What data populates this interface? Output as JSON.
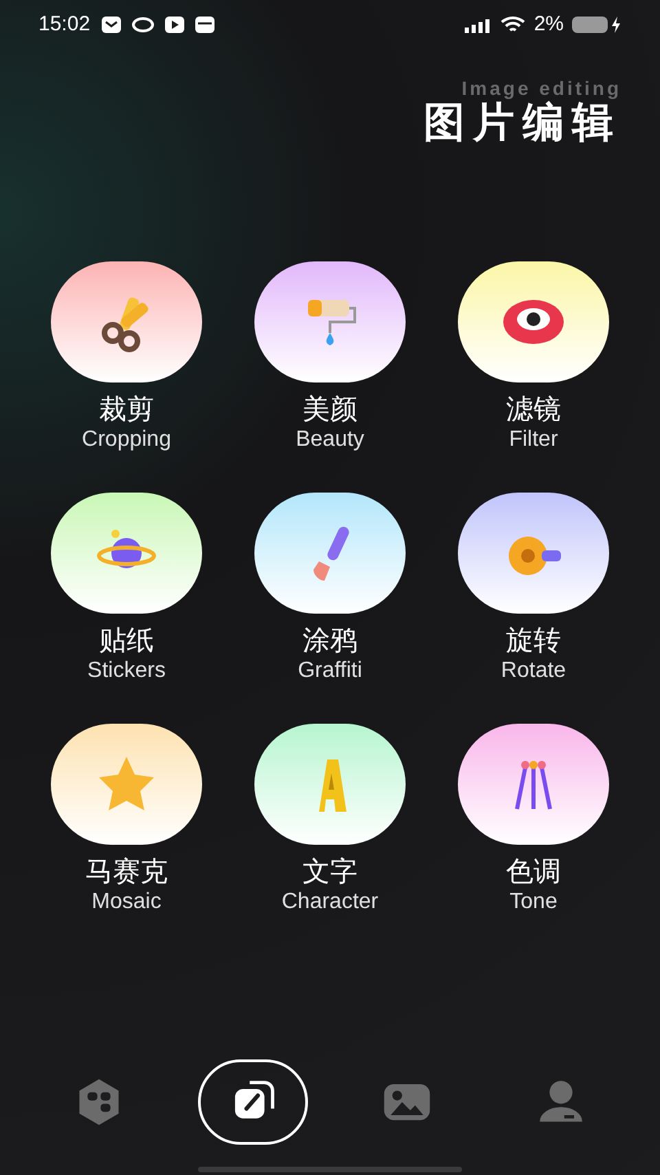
{
  "status_bar": {
    "time": "15:02",
    "battery": "2%"
  },
  "header": {
    "title": "图片编辑",
    "subtitle": "Image editing"
  },
  "tools": [
    {
      "kind": "scissors",
      "label": "裁剪",
      "caption": "Cropping",
      "color": "#fdb3b3"
    },
    {
      "kind": "roller",
      "label": "美颜",
      "caption": "Beauty",
      "color": "#e2b8fb"
    },
    {
      "kind": "eye",
      "label": "滤镜",
      "caption": "Filter",
      "color": "#fbf6a6"
    },
    {
      "kind": "planet",
      "label": "贴纸",
      "caption": "Stickers",
      "color": "#c9f7b6"
    },
    {
      "kind": "brush",
      "label": "涂鸦",
      "caption": "Graffiti",
      "color": "#b3e6fb"
    },
    {
      "kind": "tape",
      "label": "旋转",
      "caption": "Rotate",
      "color": "#c0c4fb"
    },
    {
      "kind": "star",
      "label": "马赛克",
      "caption": "Mosaic",
      "color": "#fde2b0"
    },
    {
      "kind": "letter",
      "label": "文字",
      "caption": "Character",
      "color": "#b6f5cf"
    },
    {
      "kind": "pins",
      "label": "色调",
      "caption": "Tone",
      "color": "#f9b6ea"
    }
  ],
  "nav": [
    {
      "kind": "apps",
      "selected": false
    },
    {
      "kind": "edit",
      "selected": true
    },
    {
      "kind": "gallery",
      "selected": false
    },
    {
      "kind": "profile",
      "selected": false
    }
  ]
}
